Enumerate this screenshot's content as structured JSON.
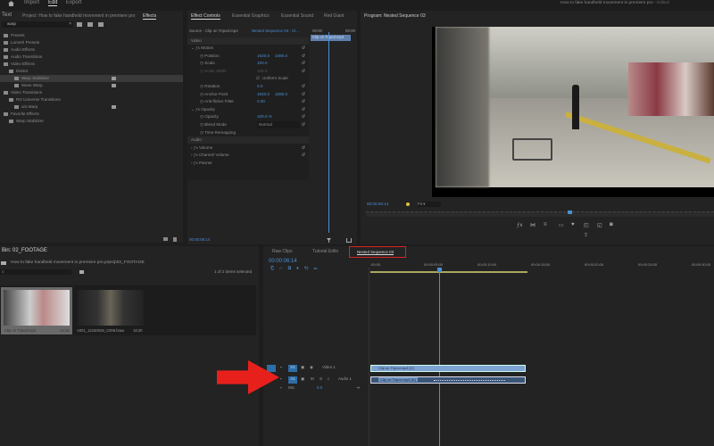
{
  "topbar": {
    "menu": [
      "Import",
      "Edit",
      "Export"
    ],
    "active": "Edit",
    "title": "How to fake handheld movement in premiere pro",
    "edited": "- Edited"
  },
  "effects_panel": {
    "tabs": [
      "Text",
      "Project: How to fake handheld movement in premiere pro",
      "Effects"
    ],
    "search_value": "warp",
    "tree": [
      {
        "label": "Presets",
        "level": 0
      },
      {
        "label": "Lumetri Presets",
        "level": 0
      },
      {
        "label": "Audio Effects",
        "level": 0
      },
      {
        "label": "Audio Transitions",
        "level": 0
      },
      {
        "label": "Video Effects",
        "level": 0
      },
      {
        "label": "Distort",
        "level": 1
      },
      {
        "label": "Warp Stabilizer",
        "level": 2,
        "selected": true
      },
      {
        "label": "Wave Warp",
        "level": 2
      },
      {
        "label": "Video Transitions",
        "level": 0
      },
      {
        "label": "RG Universe Transitions",
        "level": 1
      },
      {
        "label": "uni.Warp",
        "level": 2
      },
      {
        "label": "Favorite Effects",
        "level": 0
      },
      {
        "label": "Warp Stabilizer",
        "level": 1
      }
    ]
  },
  "effect_controls": {
    "tabs": [
      "Effect Controls",
      "Essential Graphics",
      "Essential Sound",
      "Red Giant"
    ],
    "source": "Source - Clip on Tripod.mp4",
    "sequence": "Nested Sequence 03 - Cl...",
    "time_start": "00:00",
    "time_end": "00:00",
    "clip_label": "Clip on Tripod.mp4",
    "sections": {
      "video": "Video",
      "audio": "Audio"
    },
    "rows": [
      {
        "label": "Motion",
        "fx": true
      },
      {
        "label": "Position",
        "v1": "1920.0",
        "v2": "1080.0"
      },
      {
        "label": "Scale",
        "v1": "100.0"
      },
      {
        "label": "Scale Width",
        "v1": "100.0",
        "disabled": true
      },
      {
        "label": "Uniform Scale",
        "checkbox": true
      },
      {
        "label": "Rotation",
        "v1": "0.0"
      },
      {
        "label": "Anchor Point",
        "v1": "1920.0",
        "v2": "1080.0"
      },
      {
        "label": "Anti-flicker Filter",
        "v1": "0.00"
      },
      {
        "label": "Opacity",
        "fx": true
      },
      {
        "label": "Opacity",
        "v1": "100.0 %"
      },
      {
        "label": "Blend Mode",
        "v1": "Normal"
      },
      {
        "label": "Time Remapping"
      }
    ],
    "audio_rows": [
      "Volume",
      "Channel Volume",
      "Panner"
    ],
    "timecode": "00:00:06:14"
  },
  "program": {
    "title": "Program: Nested Sequence 03",
    "timecode": "00:00:06:14",
    "fit": "Fit",
    "playhead_fraction": 0.58
  },
  "bin": {
    "title": "Bin: 02_FOOTAGE",
    "path": "How to fake handheld movement in premiere pro.prproj\\02_FOOTAGE",
    "selected_count": "1 of 2 items selected",
    "items": [
      {
        "name": "Clip on Tripod.mp4",
        "duration": "14:16"
      },
      {
        "name": "A001_12150029_C006.braw",
        "duration": "18:20"
      }
    ]
  },
  "timeline": {
    "tabs": [
      "Raw Clips",
      "Tutorial Edits",
      "Nested Sequence 03"
    ],
    "timecode": "00:00:06:14",
    "ruler": [
      ":00:00",
      "00:00:05:00",
      "00:00:10:00",
      "00:00:15:00",
      "00:00:20:00",
      "00:00:25:00",
      "00:00:30:00"
    ],
    "tracks": [
      {
        "name": "Video 1",
        "toggle": "V1",
        "clip": "Clip on Tripod.mp4 [V]"
      },
      {
        "name": "Audio 1",
        "toggle": "A1",
        "clip": "Clip on Tripod.mp4 [A]"
      }
    ],
    "mix": "Mix",
    "mix_value": "0.0"
  },
  "colors": {
    "accent": "#4a8fd6",
    "highlight_box": "#e02020",
    "arrow": "#e8201c"
  }
}
